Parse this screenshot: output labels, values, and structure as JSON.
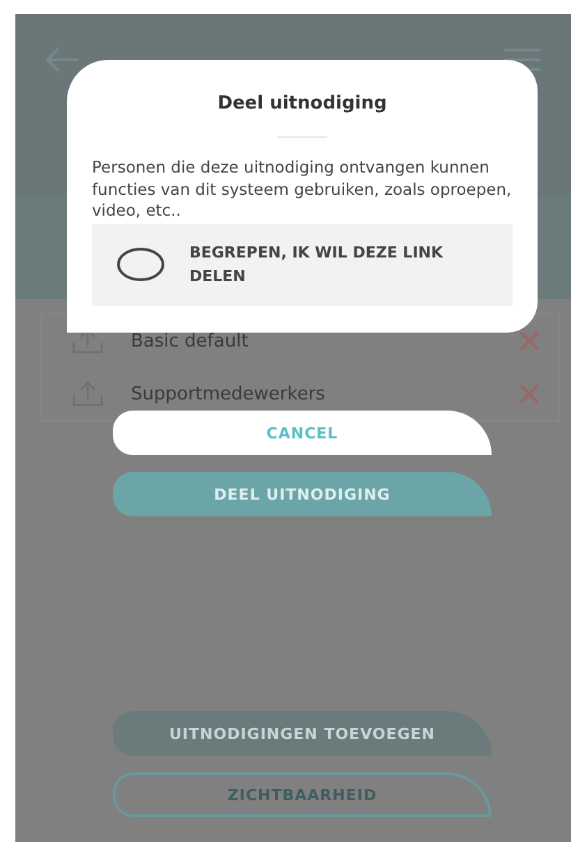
{
  "list": [
    {
      "label": "Basic default"
    },
    {
      "label": "Supportmedewerkers"
    }
  ],
  "bottom_buttons": [
    {
      "label": "UITNODIGINGEN TOEVOEGEN",
      "kind": "filled"
    },
    {
      "label": "ZICHTBAARHEID",
      "kind": "outline"
    }
  ],
  "dialog": {
    "title": "Deel uitnodiging",
    "message": "Personen die deze uitnodiging ontvangen kunnen functies van dit systeem gebruiken, zoals oproepen, video, etc..",
    "consent": {
      "label": "BEGREPEN, IK WIL DEZE LINK DELEN",
      "checked": false
    },
    "buttons": [
      {
        "label": "CANCEL",
        "kind": "secondary"
      },
      {
        "label": "DEEL UITNODIGING",
        "kind": "primary"
      }
    ]
  }
}
